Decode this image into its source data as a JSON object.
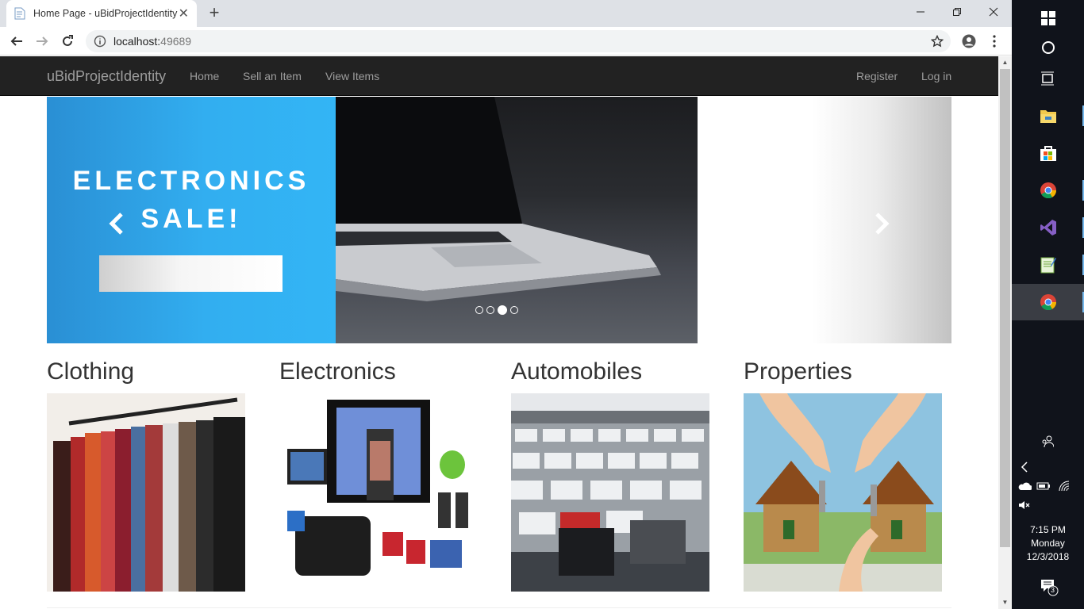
{
  "browser": {
    "tab_title": "Home Page - uBidProjectIdentity",
    "new_tab_symbol": "+",
    "close_tab_symbol": "✕",
    "url_host": "localhost:",
    "url_port": "49689"
  },
  "navbar": {
    "brand": "uBidProjectIdentity",
    "links": [
      "Home",
      "Sell an Item",
      "View Items"
    ],
    "right_links": [
      "Register",
      "Log in"
    ]
  },
  "carousel": {
    "promo_line1": "ELECTRONICS",
    "promo_line2": "SALE!",
    "active_slide": 3,
    "slide_count": 4
  },
  "categories": [
    {
      "title": "Clothing"
    },
    {
      "title": "Electronics"
    },
    {
      "title": "Automobiles"
    },
    {
      "title": "Properties"
    }
  ],
  "taskbar": {
    "time": "7:15 PM",
    "day": "Monday",
    "date": "12/3/2018",
    "notification_count": "3"
  },
  "colors": {
    "navbar_bg": "#222222",
    "promo_blue": "#33b5f5",
    "taskbar_bg": "#10131b"
  }
}
